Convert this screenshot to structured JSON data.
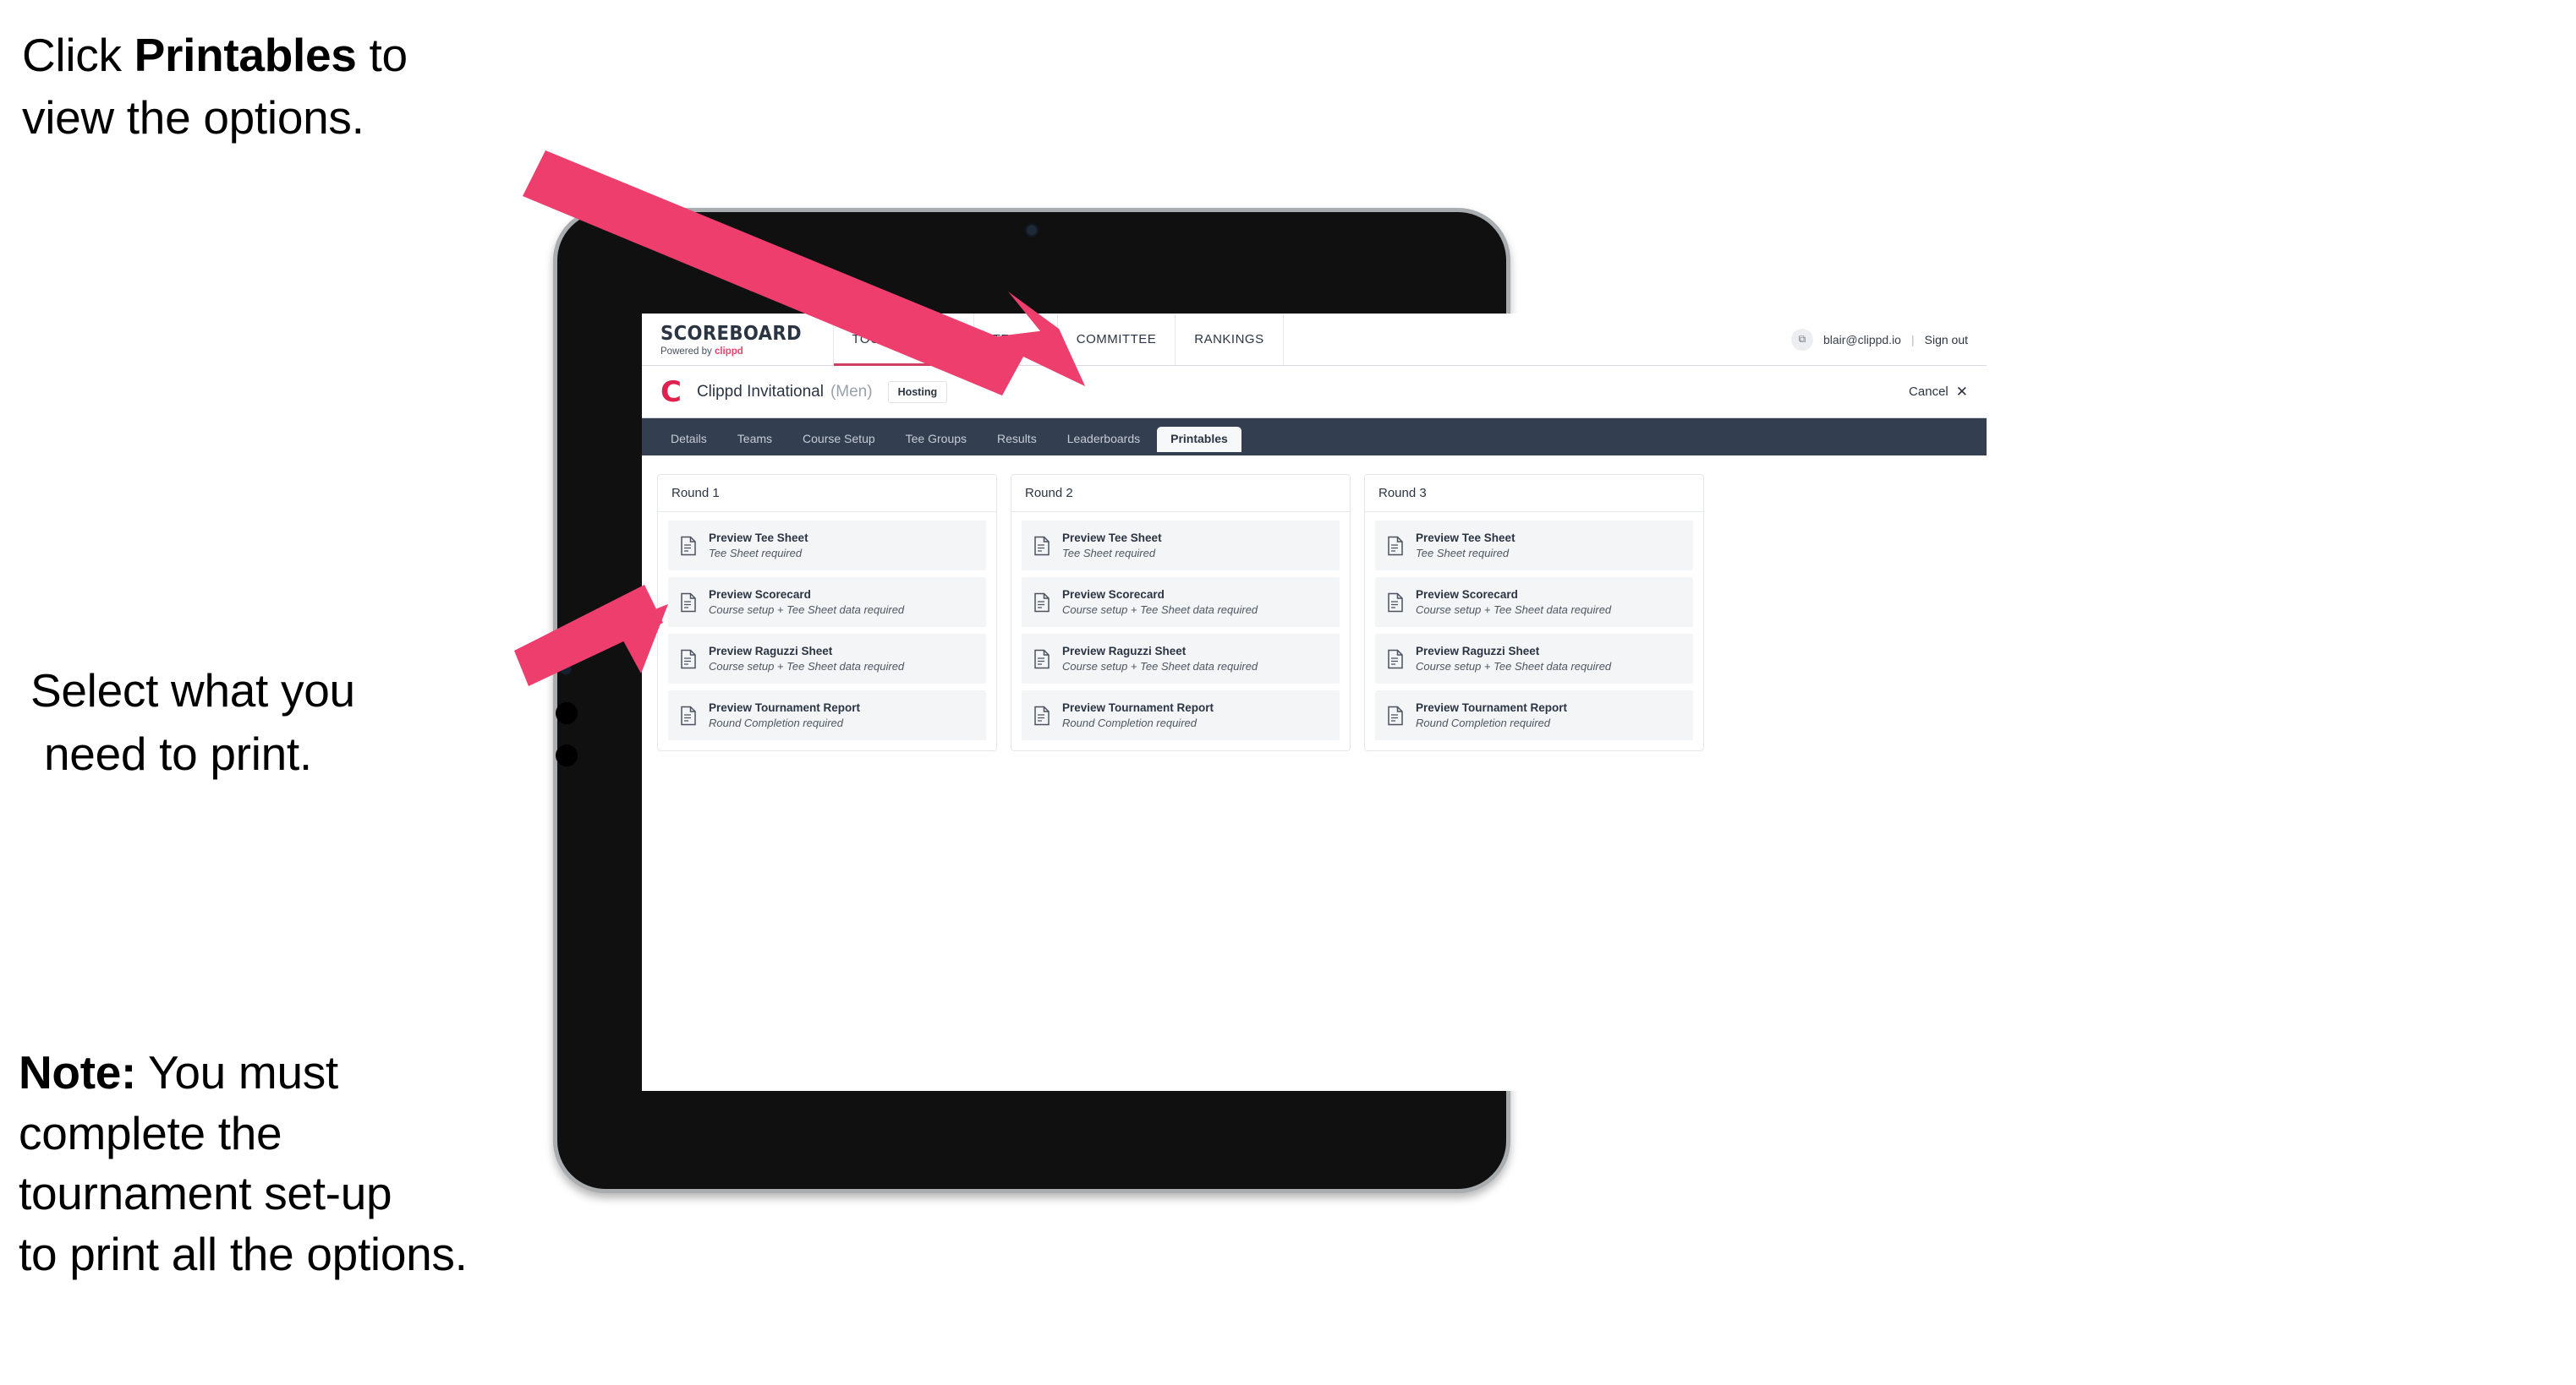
{
  "annotations": {
    "a1_line1_pre": "Click ",
    "a1_bold": "Printables",
    "a1_line1_post": " to",
    "a1_line2": "view the options.",
    "a2_line1": "Select what you",
    "a2_line2": "need to print.",
    "a3_bold": "Note:",
    "a3_line1_post": " You must",
    "a3_line2": "complete the",
    "a3_line3": "tournament set-up",
    "a3_line4": "to print all the options.",
    "arrow_color": "#ee3e6e"
  },
  "app": {
    "topnav": {
      "brand_title": "SCOREBOARD",
      "brand_sub_pre": "Powered by ",
      "brand_sub_brand": "clippd",
      "items": [
        {
          "label": "TOURNAMENTS",
          "active": true
        },
        {
          "label": "TEAMS",
          "active": false
        },
        {
          "label": "COMMITTEE",
          "active": false
        },
        {
          "label": "RANKINGS",
          "active": false
        }
      ],
      "avatar_glyph": "⧉",
      "user_email": "blair@clippd.io",
      "separator": "|",
      "signout_label": "Sign out"
    },
    "tournament_bar": {
      "logo_letter": "C",
      "name": "Clippd Invitational",
      "gender": "(Men)",
      "hosting_badge": "Hosting",
      "cancel_label": "Cancel",
      "cancel_icon": "✕"
    },
    "tabs": [
      {
        "label": "Details",
        "active": false
      },
      {
        "label": "Teams",
        "active": false
      },
      {
        "label": "Course Setup",
        "active": false
      },
      {
        "label": "Tee Groups",
        "active": false
      },
      {
        "label": "Results",
        "active": false
      },
      {
        "label": "Leaderboards",
        "active": false
      },
      {
        "label": "Printables",
        "active": true
      }
    ],
    "rounds": [
      {
        "header": "Round 1",
        "items": [
          {
            "title": "Preview Tee Sheet",
            "sub": "Tee Sheet required"
          },
          {
            "title": "Preview Scorecard",
            "sub": "Course setup + Tee Sheet data required"
          },
          {
            "title": "Preview Raguzzi Sheet",
            "sub": "Course setup + Tee Sheet data required"
          },
          {
            "title": "Preview Tournament Report",
            "sub": "Round Completion required"
          }
        ]
      },
      {
        "header": "Round 2",
        "items": [
          {
            "title": "Preview Tee Sheet",
            "sub": "Tee Sheet required"
          },
          {
            "title": "Preview Scorecard",
            "sub": "Course setup + Tee Sheet data required"
          },
          {
            "title": "Preview Raguzzi Sheet",
            "sub": "Course setup + Tee Sheet data required"
          },
          {
            "title": "Preview Tournament Report",
            "sub": "Round Completion required"
          }
        ]
      },
      {
        "header": "Round 3",
        "items": [
          {
            "title": "Preview Tee Sheet",
            "sub": "Tee Sheet required"
          },
          {
            "title": "Preview Scorecard",
            "sub": "Course setup + Tee Sheet data required"
          },
          {
            "title": "Preview Raguzzi Sheet",
            "sub": "Course setup + Tee Sheet data required"
          },
          {
            "title": "Preview Tournament Report",
            "sub": "Round Completion required"
          }
        ]
      }
    ]
  },
  "colors": {
    "navbar_dark": "#333f51",
    "brand_pink": "#e8436c",
    "accent_crimson": "#cf3f63",
    "arrow_pink": "#ee3e6e"
  }
}
